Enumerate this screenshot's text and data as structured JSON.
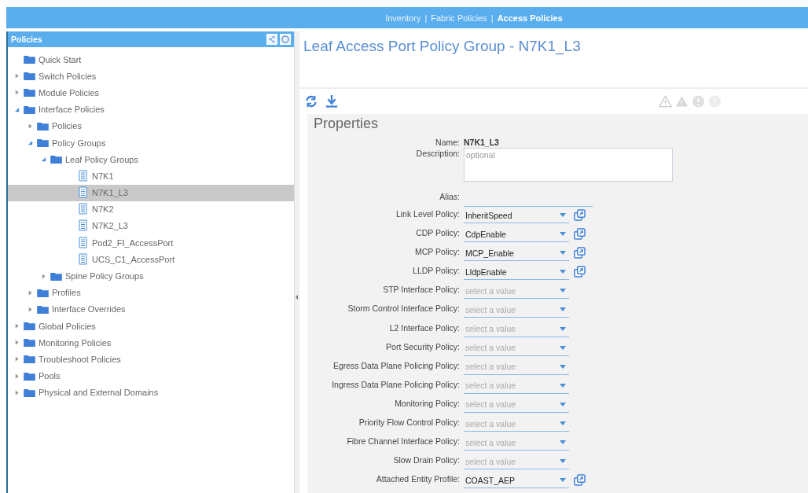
{
  "nav": [
    {
      "kind": "link",
      "label": "Inventory",
      "selected": false
    },
    {
      "kind": "separator",
      "label": "|"
    },
    {
      "kind": "link",
      "label": "Fabric Policies",
      "selected": false
    },
    {
      "kind": "separator",
      "label": "|"
    },
    {
      "kind": "link",
      "label": "Access Policies",
      "selected": true
    }
  ],
  "sidebar": {
    "title": "Policies",
    "tree": [
      {
        "label": "Quick Start",
        "kind": "folder",
        "selected": false
      },
      {
        "label": "Switch Policies",
        "kind": "folder",
        "expanded": false,
        "has_toggle": true,
        "selected": false
      },
      {
        "label": "Module Policies",
        "kind": "folder",
        "expanded": false,
        "has_toggle": true,
        "selected": false
      },
      {
        "label": "Interface Policies",
        "kind": "folder",
        "expanded": true,
        "has_toggle": true,
        "selected": false,
        "children": [
          {
            "label": "Policies",
            "kind": "folder",
            "expanded": false,
            "has_toggle": true,
            "selected": false
          },
          {
            "label": "Policy Groups",
            "kind": "folder",
            "expanded": true,
            "has_toggle": true,
            "selected": false,
            "children": [
              {
                "label": "Leaf Policy Groups",
                "kind": "folder",
                "expanded": true,
                "has_toggle": true,
                "selected": false,
                "children": [
                  {
                    "label": "N7K1",
                    "kind": "document",
                    "selected": false
                  },
                  {
                    "label": "N7K1_L3",
                    "kind": "document",
                    "selected": true
                  },
                  {
                    "label": "N7K2",
                    "kind": "document",
                    "selected": false
                  },
                  {
                    "label": "N7K2_L3",
                    "kind": "document",
                    "selected": false
                  },
                  {
                    "label": "Pod2_FI_AccessPort",
                    "kind": "document",
                    "selected": false
                  },
                  {
                    "label": "UCS_C1_AccessPort",
                    "kind": "document",
                    "selected": false
                  }
                ]
              },
              {
                "label": "Spine Policy Groups",
                "kind": "folder",
                "expanded": false,
                "has_toggle": true,
                "selected": false
              }
            ]
          },
          {
            "label": "Profiles",
            "kind": "folder",
            "expanded": false,
            "has_toggle": true,
            "selected": false
          },
          {
            "label": "Interface Overrides",
            "kind": "folder",
            "expanded": false,
            "has_toggle": true,
            "selected": false
          }
        ]
      },
      {
        "label": "Global Policies",
        "kind": "folder",
        "expanded": false,
        "has_toggle": true,
        "selected": false
      },
      {
        "label": "Monitoring Policies",
        "kind": "folder",
        "expanded": false,
        "has_toggle": true,
        "selected": false
      },
      {
        "label": "Troubleshoot Policies",
        "kind": "folder",
        "expanded": false,
        "has_toggle": true,
        "selected": false
      },
      {
        "label": "Pools",
        "kind": "folder",
        "expanded": false,
        "has_toggle": true,
        "selected": false
      },
      {
        "label": "Physical and External Domains",
        "kind": "folder",
        "expanded": false,
        "has_toggle": true,
        "selected": false
      }
    ]
  },
  "page_title": "Leaf Access Port Policy Group - N7K1_L3",
  "properties": {
    "title": "Properties",
    "fields": [
      {
        "kind": "text",
        "label": "Name:",
        "value": "N7K1_L3"
      },
      {
        "kind": "textarea",
        "label": "Description:",
        "placeholder": "optional"
      },
      {
        "kind": "input",
        "label": "Alias:"
      },
      {
        "kind": "select",
        "label": "Link Level Policy:",
        "value": "InheritSpeed",
        "has_link": true
      },
      {
        "kind": "select",
        "label": "CDP Policy:",
        "value": "CdpEnable",
        "has_link": true
      },
      {
        "kind": "select",
        "label": "MCP Policy:",
        "value": "MCP_Enable",
        "has_link": true
      },
      {
        "kind": "select",
        "label": "LLDP Policy:",
        "value": "LldpEnable",
        "has_link": true
      },
      {
        "kind": "select",
        "label": "STP Interface Policy:",
        "placeholder": "select a value"
      },
      {
        "kind": "select",
        "label": "Storm Control Interface Policy:",
        "placeholder": "select a value"
      },
      {
        "kind": "select",
        "label": "L2 Interface Policy:",
        "placeholder": "select a value"
      },
      {
        "kind": "select",
        "label": "Port Security Policy:",
        "placeholder": "select a value"
      },
      {
        "kind": "select",
        "label": "Egress Data Plane Policing Policy:",
        "placeholder": "select a value"
      },
      {
        "kind": "select",
        "label": "Ingress Data Plane Policing Policy:",
        "placeholder": "select a value"
      },
      {
        "kind": "select",
        "label": "Monitoring Policy:",
        "placeholder": "select a value"
      },
      {
        "kind": "select",
        "label": "Priority Flow Control Policy:",
        "placeholder": "select a value"
      },
      {
        "kind": "select",
        "label": "Fibre Channel Interface Policy:",
        "placeholder": "select a value"
      },
      {
        "kind": "select",
        "label": "Slow Drain Policy:",
        "placeholder": "select a value"
      },
      {
        "kind": "select",
        "label": "Attached Entity Profile:",
        "value": "COAST_AEP",
        "has_link": true
      }
    ]
  }
}
